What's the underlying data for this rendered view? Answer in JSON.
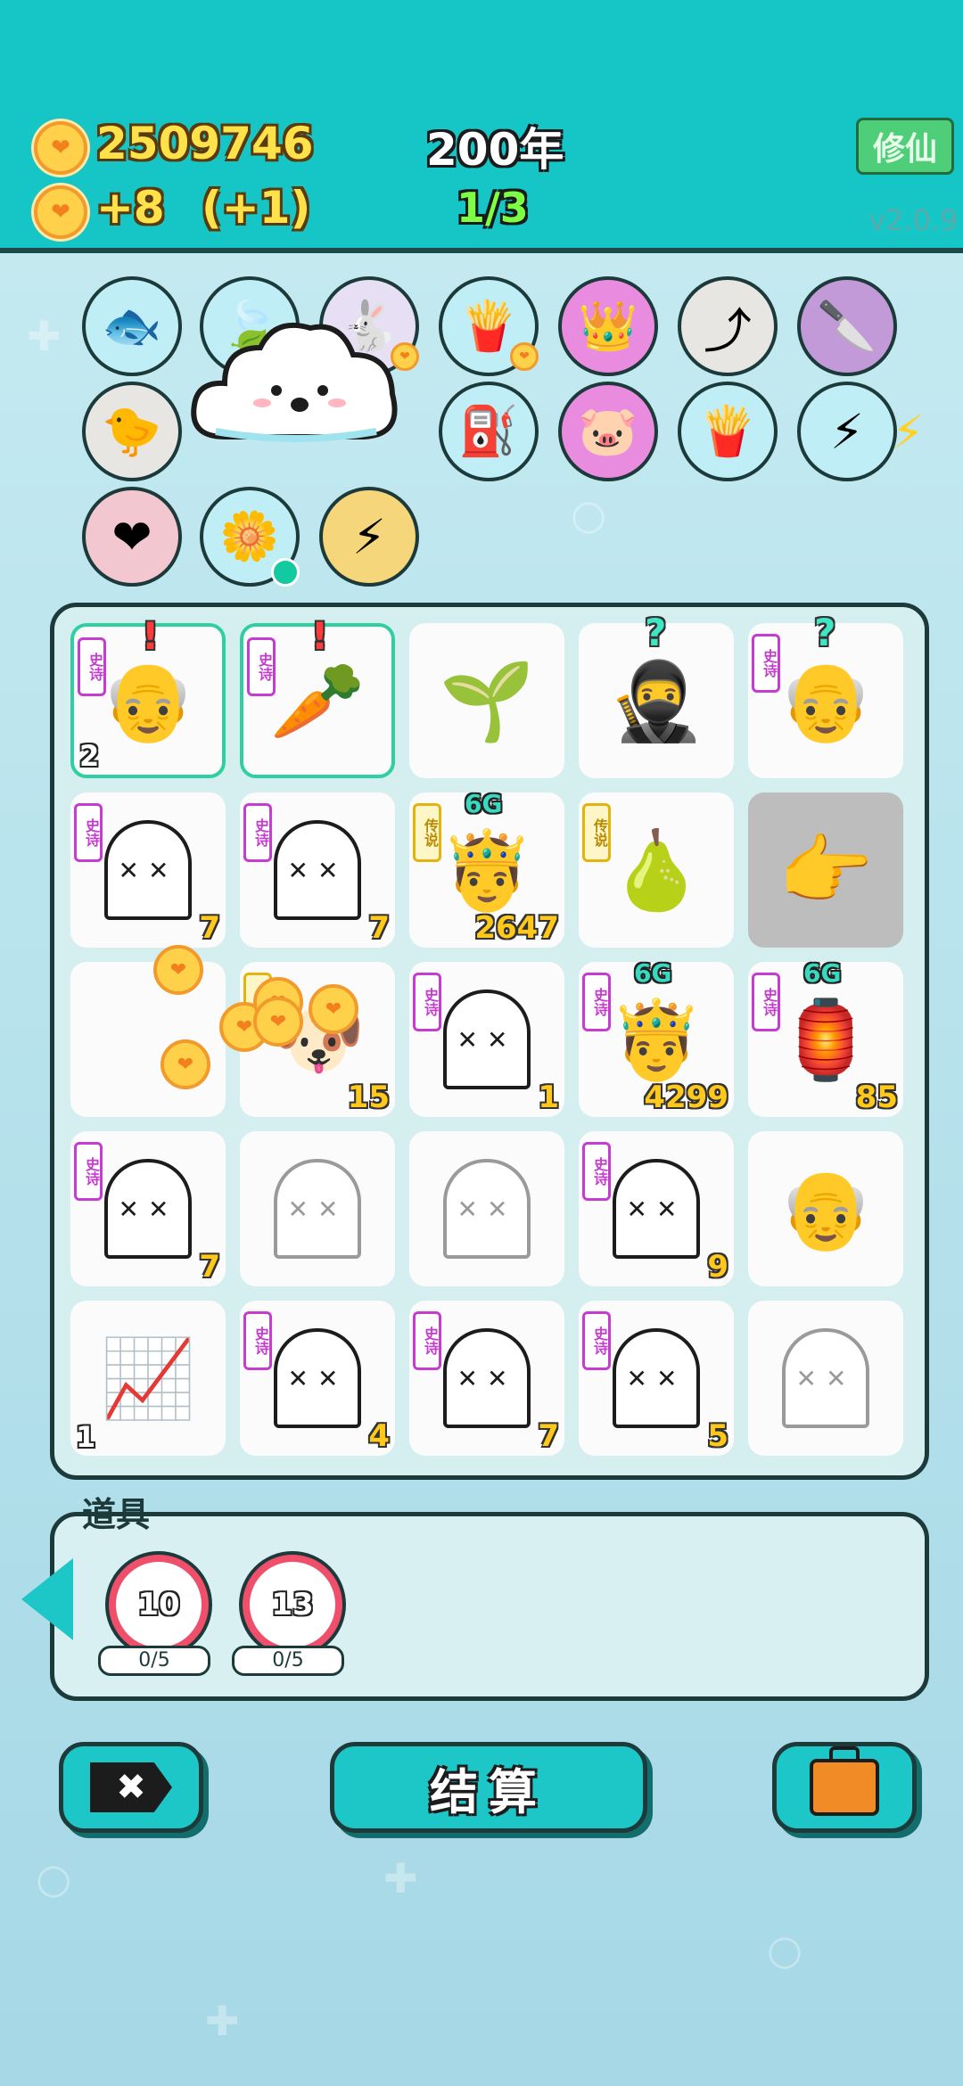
{
  "header": {
    "coins": "2509746",
    "year": "200年",
    "income": "+8",
    "income_bonus": "(+1)",
    "round": "1/3",
    "cultivate_button": "修仙",
    "version": "v2.0.9"
  },
  "skills": [
    {
      "icon": "fishbowl-icon",
      "glyph": "🐟"
    },
    {
      "icon": "leaf-icon",
      "glyph": "🍃"
    },
    {
      "icon": "rabbit-icon",
      "glyph": "🐇"
    },
    {
      "icon": "fries-icon",
      "glyph": "🍟"
    },
    {
      "icon": "crown-box-icon",
      "glyph": "👑"
    },
    {
      "icon": "upgrade-arrow-icon",
      "glyph": "⤴"
    },
    {
      "icon": "cleaver-icon",
      "glyph": "🔪"
    },
    {
      "icon": "chick-icon",
      "glyph": "🐤"
    },
    {
      "icon": "pump-icon",
      "glyph": "⛽"
    },
    {
      "icon": "piggy-bank-icon",
      "glyph": "🐷"
    },
    {
      "icon": "fries-lightning-icon",
      "glyph": "🍟"
    },
    {
      "icon": "fries-sticks-icon",
      "glyph": "⚡"
    },
    {
      "icon": "heart-fan-icon",
      "glyph": "❤"
    },
    {
      "icon": "flower-pot-icon",
      "glyph": "🌼"
    },
    {
      "icon": "lightning-icon",
      "glyph": "⚡"
    }
  ],
  "tag_labels": {
    "epic": "史诗",
    "legend": "传说"
  },
  "board_rows": [
    [
      {
        "icon": "grandpa-face-icon",
        "glyph": "👴",
        "tag": "史诗",
        "alert": "!",
        "count_left": "2",
        "selected": true
      },
      {
        "icon": "carrot-icon",
        "glyph": "🥕",
        "tag": "史诗",
        "alert": "!",
        "selected": true
      },
      {
        "icon": "sprout-icon",
        "glyph": "🌱"
      },
      {
        "icon": "thief-face-icon",
        "glyph": "🥷",
        "question": "?"
      },
      {
        "icon": "bald-grandpa-icon",
        "glyph": "👴",
        "tag": "史诗",
        "question": "?"
      }
    ],
    [
      {
        "icon": "ghost-icon",
        "tag": "史诗",
        "count": "7"
      },
      {
        "icon": "ghost-icon",
        "tag": "史诗",
        "count": "7"
      },
      {
        "icon": "king-face-icon",
        "glyph": "🤴",
        "tag": "传说",
        "sixg": "6G",
        "count": "2647"
      },
      {
        "icon": "fruit-icon",
        "glyph": "🍐",
        "tag": "传说"
      },
      {
        "icon": "pointing-hand-icon",
        "glyph": "👉",
        "grey": true
      }
    ],
    [
      {
        "icon": "empty-cell"
      },
      {
        "icon": "dog-icon",
        "glyph": "🐶",
        "tag": "传说",
        "count": "15"
      },
      {
        "icon": "ghost-icon",
        "tag": "史诗",
        "count": "1"
      },
      {
        "icon": "bearded-king-icon",
        "glyph": "🤴",
        "tag": "史诗",
        "sixg": "6G",
        "count": "4299"
      },
      {
        "icon": "rabbit-house-icon",
        "glyph": "🏮",
        "tag": "史诗",
        "sixg": "6G",
        "count": "85"
      }
    ],
    [
      {
        "icon": "ghost-icon",
        "tag": "史诗",
        "count": "7"
      },
      {
        "icon": "ghost-icon",
        "faint": true
      },
      {
        "icon": "ghost-icon",
        "faint": true
      },
      {
        "icon": "ghost-icon",
        "tag": "史诗",
        "count": "9"
      },
      {
        "icon": "grandpa-face-icon",
        "glyph": "👴"
      }
    ],
    [
      {
        "icon": "trend-chart-icon",
        "glyph": "📈",
        "count_left": "1"
      },
      {
        "icon": "ghost-icon",
        "tag": "史诗",
        "count": "4"
      },
      {
        "icon": "ghost-icon",
        "tag": "史诗",
        "count": "7"
      },
      {
        "icon": "ghost-icon",
        "tag": "史诗",
        "count": "5"
      },
      {
        "icon": "ghost-icon",
        "faint": true
      }
    ]
  ],
  "tools": {
    "label": "道具",
    "items": [
      {
        "value": "10",
        "uses": "0/5"
      },
      {
        "value": "13",
        "uses": "0/5"
      }
    ]
  },
  "buttons": {
    "settle_label": "结算",
    "close_glyph": "✖"
  },
  "colors": {
    "header": "#16c6c6",
    "accent": "#1dc7c7",
    "coin": "#ffd04a",
    "epic_tag": "#c63bd0",
    "legend_tag": "#e3b40c"
  }
}
